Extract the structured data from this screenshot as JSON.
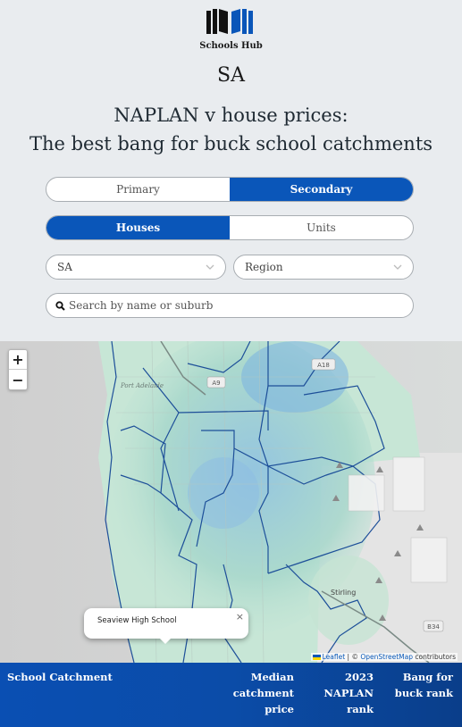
{
  "brand": {
    "name": "Schools Hub",
    "logo_icon": "books-icon"
  },
  "region_title": "SA",
  "title_line1": "NAPLAN v house prices:",
  "title_line2": "The best bang for buck school catchments",
  "level_toggle": {
    "options": [
      "Primary",
      "Secondary"
    ],
    "selected": "Secondary"
  },
  "type_toggle": {
    "options": [
      "Houses",
      "Units"
    ],
    "selected": "Houses"
  },
  "filters": {
    "state": {
      "value": "SA",
      "icon": "chevron-down-icon"
    },
    "region": {
      "value": "Region",
      "icon": "chevron-down-icon"
    }
  },
  "search": {
    "placeholder": "Search by name or suburb",
    "value": "",
    "icon": "search-icon"
  },
  "map": {
    "zoom_in_label": "+",
    "zoom_out_label": "−",
    "popup": {
      "text": "Seaview High School",
      "close_label": "×"
    },
    "labels": {
      "road_a9": "A9",
      "road_a18": "A18",
      "road_b34": "B34",
      "town_stirling": "Stirling",
      "suburb_port": "Port Adelaide"
    },
    "attribution": {
      "leaflet": "Leaflet",
      "separator": " | © ",
      "osm": "OpenStreetMap",
      "suffix": " contributors"
    }
  },
  "table": {
    "columns": [
      {
        "label": "School Catchment"
      },
      {
        "label_lines": [
          "Median",
          "catchment",
          "price"
        ]
      },
      {
        "label_lines": [
          "2023",
          "NAPLAN",
          "rank"
        ]
      },
      {
        "label_lines": [
          "Bang for",
          "buck rank"
        ]
      }
    ]
  },
  "colors": {
    "accent": "#0a56b9",
    "background": "#e9ecef",
    "header_dark": "#0a3e8a"
  }
}
